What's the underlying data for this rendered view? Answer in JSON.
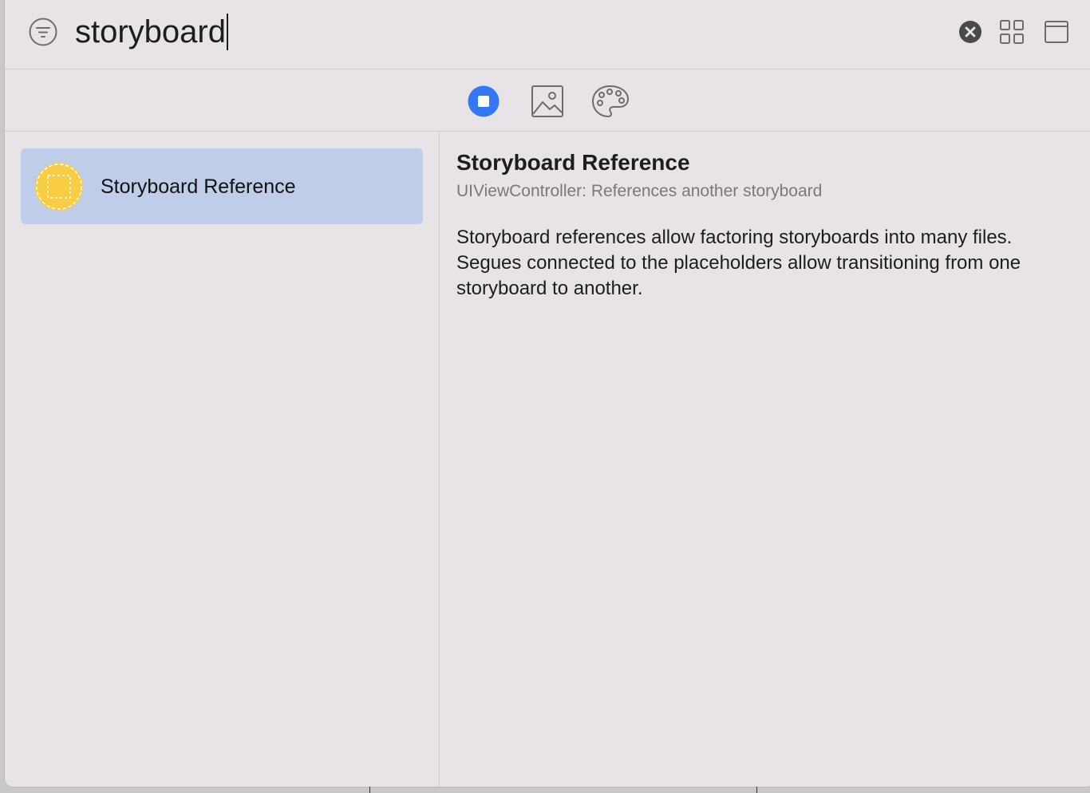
{
  "search": {
    "query": "storyboard"
  },
  "icons": {
    "filter": "filter-icon",
    "clear": "clear-circle-icon",
    "grid_view": "grid-view-icon",
    "window_layout": "window-layout-icon",
    "objects": "objects-square-icon",
    "media": "image-icon",
    "colors": "palette-icon",
    "storyboard_reference": "storyboard-reference-icon"
  },
  "colors": {
    "accent": "#3478f6",
    "selection": "#c0cde8",
    "item_icon_fill": "#f8cd44"
  },
  "library": {
    "items": [
      {
        "label": "Storyboard Reference",
        "selected": true
      }
    ]
  },
  "detail": {
    "title": "Storyboard Reference",
    "subtitle": "UIViewController: References another storyboard",
    "description": "Storyboard references allow factoring storyboards into many files. Segues connected to the placeholders allow transitioning from one storyboard to another."
  }
}
